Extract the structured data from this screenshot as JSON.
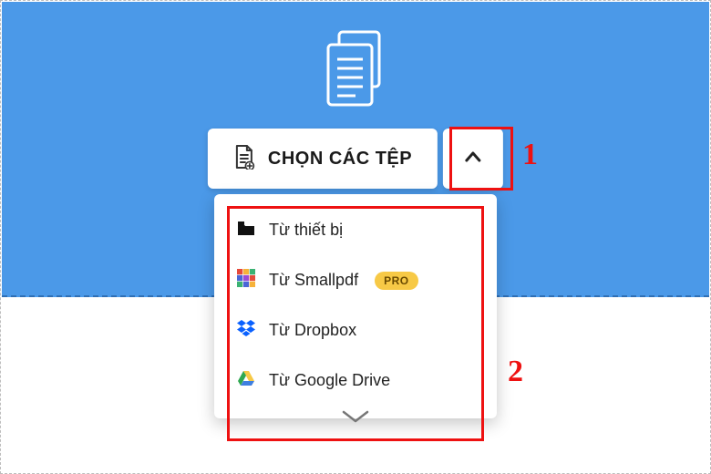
{
  "choose": {
    "label": "CHỌN CÁC TỆP"
  },
  "menu": {
    "items": [
      {
        "label": "Từ thiết bị",
        "pro": false
      },
      {
        "label": "Từ Smallpdf",
        "pro": true
      },
      {
        "label": "Từ Dropbox",
        "pro": false
      },
      {
        "label": "Từ Google Drive",
        "pro": false
      }
    ],
    "pro_label": "PRO"
  },
  "annotations": {
    "one": "1",
    "two": "2"
  }
}
